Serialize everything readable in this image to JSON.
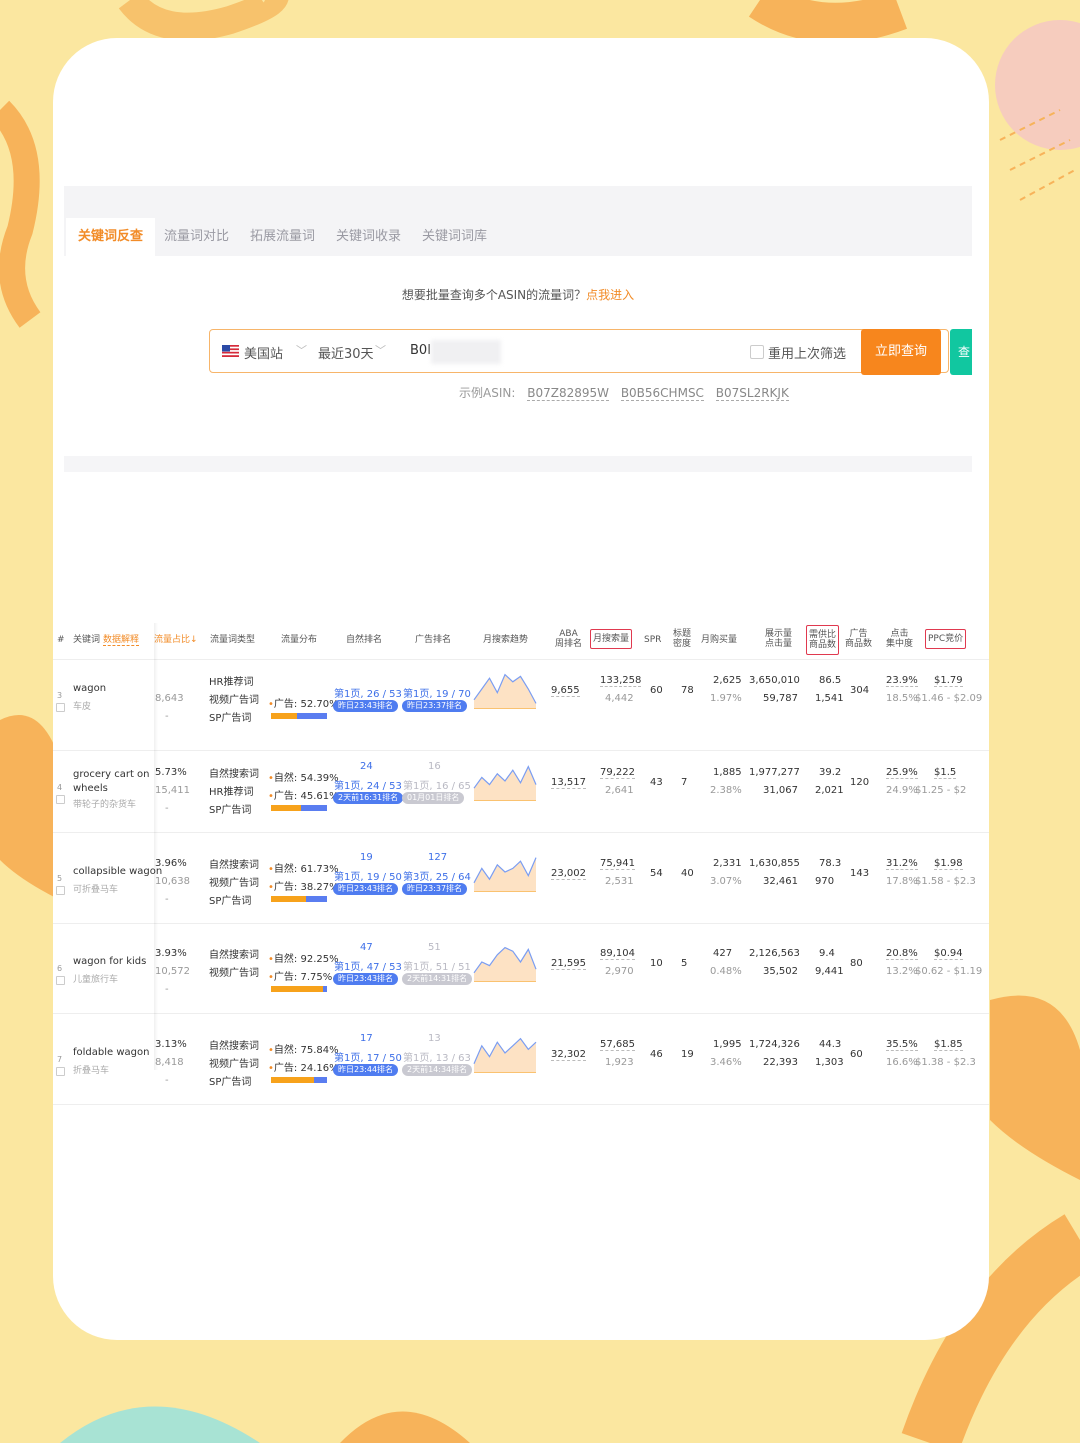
{
  "tabs": [
    {
      "label": "关键词反查",
      "active": true
    },
    {
      "label": "流量词对比",
      "active": false
    },
    {
      "label": "拓展流量词",
      "active": false
    },
    {
      "label": "关键词收录",
      "active": false
    },
    {
      "label": "关键词词库",
      "active": false
    }
  ],
  "hint": {
    "text": "想要批量查询多个ASIN的流量词？",
    "link": "点我进入"
  },
  "search": {
    "site": "美国站",
    "period": "最近30天",
    "asin_prefix": "B0I",
    "reuse_label": "重用上次筛选",
    "query_button": "立即查询",
    "extra_button": "查"
  },
  "examples": {
    "label": "示例ASIN:",
    "asins": [
      "B07Z82895W",
      "B0B56CHMSC",
      "B07SL2RKJK"
    ]
  },
  "colors": {
    "accent": "#f7861d",
    "blue": "#4f7cf0",
    "green": "#11c7a0",
    "red_box": "#e0394f"
  },
  "table": {
    "headers": {
      "num": "#",
      "keyword": "关键词",
      "keyword_tag": "数据解释",
      "traffic_share": "流量占比↓",
      "type": "流量词类型",
      "distribution": "流量分布",
      "organic_rank": "自然排名",
      "ad_rank": "广告排名",
      "trend": "月搜索趋势",
      "aba": "ABA\n周排名",
      "monthly_search": "月搜索量",
      "spr": "SPR",
      "title_density": "标题\n密度",
      "monthly_purchase": "月购买量",
      "impressions": "展示量\n点击量",
      "demand_supply": "需供比\n商品数",
      "ad_products": "广告\n商品数",
      "click_conc": "点击\n集中度",
      "ppc": "PPC竞价"
    },
    "rows": [
      {
        "idx": "3",
        "kw_en": "wagon",
        "kw_cn": "车皮",
        "share": "",
        "share_sub": "8,643",
        "types": [
          "HR推荐词",
          "视频广告词",
          "SP广告词"
        ],
        "natural_label": "",
        "natural_pct": "",
        "ad_label": "广告:",
        "ad_pct": "52.70%",
        "natural_frac": 0.47,
        "ad_frac": 0.53,
        "org_top": "",
        "org_page": "第1页, 26 / 53",
        "org_pill": "昨日23:43排名",
        "ad_top": "",
        "ad_page": "第1页, 19 / 70",
        "ad_pill": "昨日23:37排名",
        "aba": "9,655",
        "ms": "133,258",
        "ms_sub": "4,442",
        "spr": "60",
        "td": "78",
        "mp": "2,625",
        "mp_pct": "1.97%",
        "imp": "3,650,010",
        "clk": "59,787",
        "ds": "86.5",
        "prod": "1,541",
        "adp": "304",
        "cc": "23.9%",
        "cc_sub": "18.5%",
        "ppc": "$1.79",
        "ppc_range": "$1.46 - $2.09",
        "trend": [
          0.8,
          0.5,
          0.2,
          0.6,
          0.1,
          0.3,
          0.15,
          0.5,
          0.9
        ]
      },
      {
        "idx": "4",
        "kw_en": "grocery cart on",
        "kw_en2": "wheels",
        "kw_cn": "带轮子的杂货车",
        "share": "5.73%",
        "share_sub": "15,411",
        "types": [
          "自然搜索词",
          "HR推荐词",
          "SP广告词"
        ],
        "natural_label": "自然:",
        "natural_pct": "54.39%",
        "ad_label": "广告:",
        "ad_pct": "45.61%",
        "natural_frac": 0.54,
        "ad_frac": 0.46,
        "org_top": "24",
        "org_page": "第1页, 24 / 53",
        "org_pill": "2天前16:31排名",
        "ad_top": "16",
        "ad_page": "第1页, 16 / 65",
        "ad_pill": "01月01日排名",
        "ad_grey": true,
        "aba": "13,517",
        "ms": "79,222",
        "ms_sub": "2,641",
        "spr": "43",
        "td": "7",
        "mp": "1,885",
        "mp_pct": "2.38%",
        "imp": "1,977,277",
        "clk": "31,067",
        "ds": "39.2",
        "prod": "2,021",
        "adp": "120",
        "cc": "25.9%",
        "cc_sub": "24.9%",
        "ppc": "$1.5",
        "ppc_range": "$1.25 - $2",
        "trend": [
          0.7,
          0.4,
          0.6,
          0.3,
          0.5,
          0.2,
          0.55,
          0.1,
          0.6
        ]
      },
      {
        "idx": "5",
        "kw_en": "collapsible wagon",
        "kw_cn": "可折叠马车",
        "share": "3.96%",
        "share_sub": "10,638",
        "types": [
          "自然搜索词",
          "视频广告词",
          "SP广告词"
        ],
        "natural_label": "自然:",
        "natural_pct": "61.73%",
        "ad_label": "广告:",
        "ad_pct": "38.27%",
        "natural_frac": 0.62,
        "ad_frac": 0.38,
        "org_top": "19",
        "org_page": "第1页, 19 / 50",
        "org_pill": "昨日23:43排名",
        "ad_top": "127",
        "ad_page": "第3页, 25 / 64",
        "ad_pill": "昨日23:37排名",
        "aba": "23,002",
        "ms": "75,941",
        "ms_sub": "2,531",
        "spr": "54",
        "td": "40",
        "mp": "2,331",
        "mp_pct": "3.07%",
        "imp": "1,630,855",
        "clk": "32,461",
        "ds": "78.3",
        "prod": "970",
        "adp": "143",
        "cc": "31.2%",
        "cc_sub": "17.8%",
        "ppc": "$1.98",
        "ppc_range": "$1.58 - $2.3",
        "trend": [
          0.8,
          0.4,
          0.7,
          0.3,
          0.5,
          0.4,
          0.2,
          0.6,
          0.1
        ]
      },
      {
        "idx": "6",
        "kw_en": "wagon for kids",
        "kw_cn": "儿童旅行车",
        "share": "3.93%",
        "share_sub": "10,572",
        "types": [
          "自然搜索词",
          "视频广告词"
        ],
        "natural_label": "自然:",
        "natural_pct": "92.25%",
        "ad_label": "广告:",
        "ad_pct": "7.75%",
        "natural_frac": 0.92,
        "ad_frac": 0.08,
        "org_top": "47",
        "org_page": "第1页, 47 / 53",
        "org_pill": "昨日23:43排名",
        "ad_top": "51",
        "ad_page": "第1页, 51 / 51",
        "ad_pill": "2天前14:31排名",
        "ad_grey": true,
        "aba": "21,595",
        "ms": "89,104",
        "ms_sub": "2,970",
        "spr": "10",
        "td": "5",
        "mp": "427",
        "mp_pct": "0.48%",
        "imp": "2,126,563",
        "clk": "35,502",
        "ds": "9.4",
        "prod": "9,441",
        "adp": "80",
        "cc": "20.8%",
        "cc_sub": "13.2%",
        "ppc": "$0.94",
        "ppc_range": "$0.62 - $1.19",
        "trend": [
          0.8,
          0.5,
          0.6,
          0.3,
          0.1,
          0.2,
          0.5,
          0.15,
          0.7
        ]
      },
      {
        "idx": "7",
        "kw_en": "foldable wagon",
        "kw_cn": "折叠马车",
        "share": "3.13%",
        "share_sub": "8,418",
        "types": [
          "自然搜索词",
          "视频广告词",
          "SP广告词"
        ],
        "natural_label": "自然:",
        "natural_pct": "75.84%",
        "ad_label": "广告:",
        "ad_pct": "24.16%",
        "natural_frac": 0.76,
        "ad_frac": 0.24,
        "org_top": "17",
        "org_page": "第1页, 17 / 50",
        "org_pill": "昨日23:44排名",
        "ad_top": "13",
        "ad_page": "第1页, 13 / 63",
        "ad_pill": "2天前14:34排名",
        "ad_grey": true,
        "aba": "32,302",
        "ms": "57,685",
        "ms_sub": "1,923",
        "spr": "46",
        "td": "19",
        "mp": "1,995",
        "mp_pct": "3.46%",
        "imp": "1,724,326",
        "clk": "22,393",
        "ds": "44.3",
        "prod": "1,303",
        "adp": "60",
        "cc": "35.5%",
        "cc_sub": "16.6%",
        "ppc": "$1.85",
        "ppc_range": "$1.38 - $2.3",
        "trend": [
          0.8,
          0.3,
          0.6,
          0.2,
          0.5,
          0.3,
          0.1,
          0.4,
          0.2
        ]
      }
    ]
  }
}
